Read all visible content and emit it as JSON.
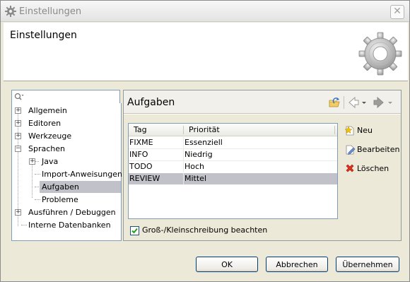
{
  "window": {
    "title": "Einstellungen",
    "close_glyph": "✕"
  },
  "header": {
    "title": "Einstellungen",
    "icon": "gear-large-icon"
  },
  "filter": {
    "value": "",
    "placeholder": "",
    "icon": "search-icon"
  },
  "tree": {
    "items": [
      {
        "label": "Allgemein",
        "expander": "+"
      },
      {
        "label": "Editoren",
        "expander": "+"
      },
      {
        "label": "Werkzeuge",
        "expander": "+"
      },
      {
        "label": "Sprachen",
        "expander": "−"
      },
      {
        "label": "Java",
        "expander": "+"
      },
      {
        "label": "Import-Anweisungen"
      },
      {
        "label": "Aufgaben",
        "selected": true
      },
      {
        "label": "Probleme"
      },
      {
        "label": "Ausführen / Debuggen",
        "expander": "+"
      },
      {
        "label": "Interne Datenbanken"
      }
    ]
  },
  "panel": {
    "title": "Aufgaben",
    "toolbar": [
      "restore-defaults-icon",
      "back-arrow-icon",
      "forward-arrow-icon"
    ]
  },
  "table": {
    "columns": [
      "Tag",
      "Priorität"
    ],
    "rows": [
      {
        "tag": "FIXME",
        "priority": "Essenziell"
      },
      {
        "tag": "INFO",
        "priority": "Niedrig"
      },
      {
        "tag": "TODO",
        "priority": "Hoch"
      },
      {
        "tag": "REVIEW",
        "priority": "Mittel",
        "selected": true
      }
    ]
  },
  "side_buttons": {
    "new": "Neu",
    "edit": "Bearbeiten",
    "delete": "Löschen"
  },
  "case_sensitive": {
    "label": "Groß-/Kleinschreibung beachten",
    "checked": true
  },
  "footer": {
    "ok": "OK",
    "cancel": "Abbrechen",
    "apply": "Übernehmen"
  },
  "colors": {
    "selection": "#c1c1c9",
    "background": "#ece9d8",
    "border": "#7f9db9"
  }
}
